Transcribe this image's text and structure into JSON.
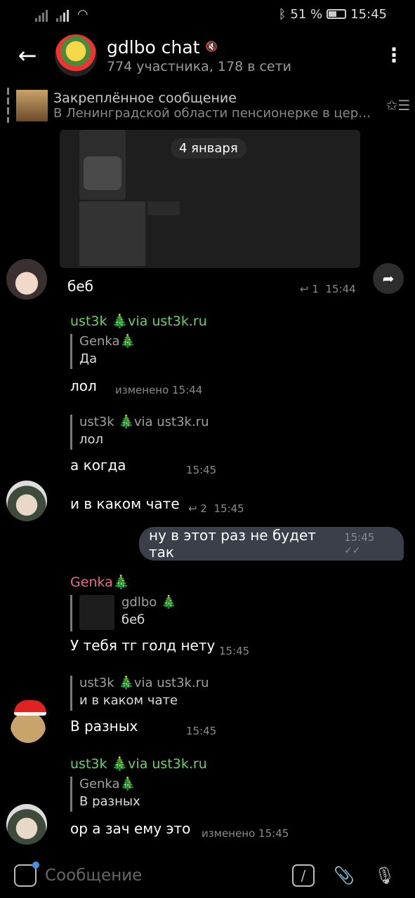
{
  "status_bar": {
    "battery": "51 %",
    "time": "15:45"
  },
  "header": {
    "title": "gdlbo chat",
    "subtitle": "774 участника, 178 в сети"
  },
  "pinned": {
    "title": "Закреплённое сообщение",
    "preview": "В Ленинградской области пенсионерке в церк…"
  },
  "date_chip": "4 января",
  "messages": [
    {
      "text": "беб",
      "replies": "1",
      "time": "15:44"
    },
    {
      "sender": "ust3k 🎄via ust3k.ru",
      "quote_name": "Genka🎄",
      "quote_text": "Да",
      "text": "лол",
      "meta": "изменено 15:44"
    },
    {
      "quote_name": "ust3k 🎄via ust3k.ru",
      "quote_text": "лол",
      "text": "а когда",
      "time": "15:45"
    },
    {
      "text": "и в каком чате",
      "replies": "2",
      "time": "15:45"
    },
    {
      "text": "ну в этот раз не будет так",
      "time": "15:45",
      "outgoing": true
    },
    {
      "sender": "Genka🎄",
      "quote_name": "gdlbo 🎄",
      "quote_text": "беб",
      "text": "У тебя тг голд нету",
      "time": "15:45"
    },
    {
      "quote_name": "ust3k 🎄via ust3k.ru",
      "quote_text": "и в каком чате",
      "text": "В разных",
      "time": "15:45"
    },
    {
      "sender": "ust3k 🎄via ust3k.ru",
      "quote_name": "Genka🎄",
      "quote_text": "В разных",
      "text": "ор а зач ему это",
      "meta": "изменено 15:45"
    }
  ],
  "input": {
    "placeholder": "Сообщение"
  },
  "icons": {
    "back": "arrow-left-icon",
    "more": "more-vertical-icon",
    "mute": "mute-icon",
    "unpin": "unpin-list-icon",
    "forward": "forward-icon",
    "reply_count": "reply-icon",
    "sticker": "sticker-icon",
    "commands": "slash-command-icon",
    "attach": "paperclip-icon",
    "mic": "microphone-icon"
  }
}
